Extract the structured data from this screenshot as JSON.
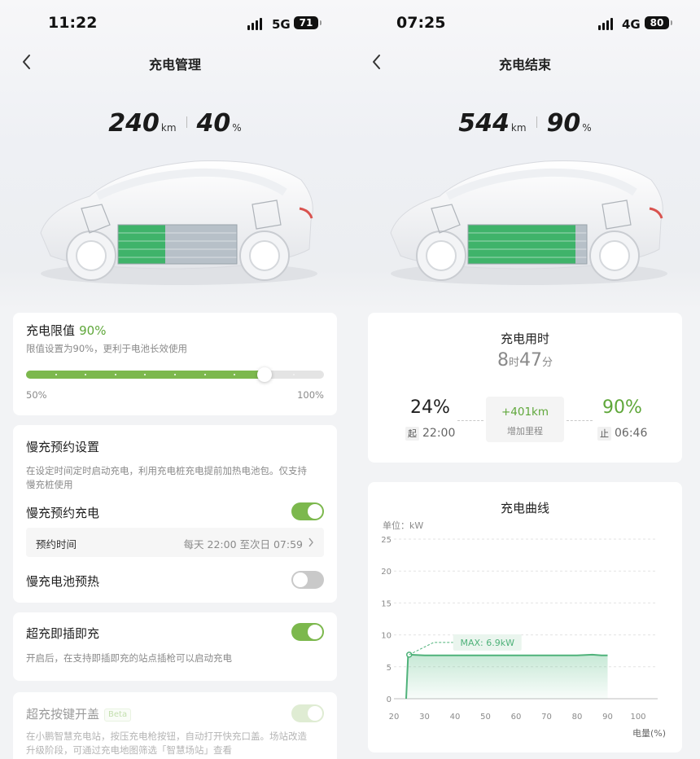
{
  "left": {
    "status": {
      "time": "11:22",
      "network": "5G",
      "battery": "71"
    },
    "nav_title": "充电管理",
    "range_km": "240",
    "range_unit": "km",
    "soc": "40",
    "soc_unit": "%",
    "charge_limit": {
      "title": "充电限值",
      "value": "90%",
      "desc": "限值设置为90%，更利于电池长效使用",
      "min_label": "50%",
      "max_label": "100%",
      "slider_min": 50,
      "slider_max": 100,
      "slider_value": 90
    },
    "slow_schedule": {
      "title": "慢充预约设置",
      "desc_line1": "在设定时间定时启动充电，利用充电桩充电提前加热电池包。仅支持",
      "desc_line2": "慢充桩使用",
      "toggle_label": "慢充预约充电",
      "toggle_on": true,
      "time_label": "预约时间",
      "time_value": "每天 22:00 至次日 07:59",
      "preheat_label": "慢充电池预热",
      "preheat_on": false
    },
    "super_plug": {
      "title": "超充即插即充",
      "on": true,
      "desc": "开启后，在支持即插即充的站点插枪可以启动充电"
    },
    "super_button": {
      "title": "超充按键开盖",
      "badge": "Beta",
      "desc_line1": "在小鹏智慧充电站，按压充电枪按钮，自动打开快充口盖。场站改造",
      "desc_line2": "升级阶段，可通过充电地图筛选「智慧场站」查看"
    },
    "colors": {
      "accent": "#7cb84d",
      "battery_green": "#3fb36a"
    }
  },
  "right": {
    "status": {
      "time": "07:25",
      "network": "4G",
      "battery": "80"
    },
    "nav_title": "充电结束",
    "range_km": "544",
    "range_unit": "km",
    "soc": "90",
    "soc_unit": "%",
    "duration": {
      "title": "充电用时",
      "hours": "8",
      "hours_unit": "时",
      "minutes": "47",
      "minutes_unit": "分",
      "start_soc": "24%",
      "start_tag": "起",
      "start_time": "22:00",
      "added_km": "+401km",
      "added_label": "增加里程",
      "end_soc": "90%",
      "end_tag": "止",
      "end_time": "06:46"
    },
    "curve_title": "充电曲线",
    "chart_data": {
      "type": "area",
      "unit_label": "单位：kW",
      "xlabel": "电量(%)",
      "xlim": [
        20,
        100
      ],
      "ylim": [
        0,
        25
      ],
      "x_ticks": [
        "20",
        "30",
        "40",
        "50",
        "60",
        "70",
        "80",
        "90",
        "100"
      ],
      "y_ticks": [
        "0",
        "5",
        "10",
        "15",
        "20",
        "25"
      ],
      "annotation": "MAX: 6.9kW",
      "max_point": [
        25,
        6.9
      ],
      "x": [
        24,
        24.6,
        25,
        30,
        40,
        50,
        60,
        70,
        80,
        85,
        88,
        90
      ],
      "y": [
        0,
        6.6,
        6.9,
        6.8,
        6.8,
        6.8,
        6.8,
        6.8,
        6.8,
        6.9,
        6.8,
        6.8
      ],
      "grid": true
    }
  }
}
